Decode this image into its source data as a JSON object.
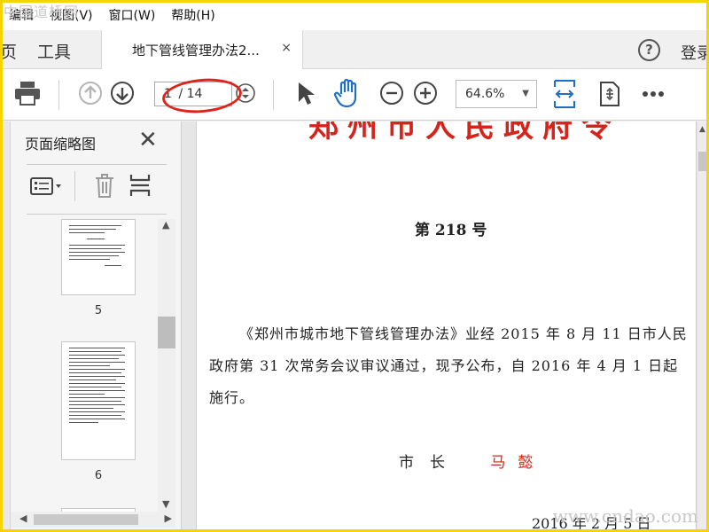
{
  "watermark": {
    "top_left": "中国道桥网",
    "bottom_right": "www.cndao.com"
  },
  "menubar": {
    "items": [
      "编辑",
      "视图(V)",
      "窗口(W)",
      "帮助(H)"
    ]
  },
  "tabs": {
    "home_partial": "页",
    "tools": "工具",
    "document": "地下管线管理办法2...",
    "close": "×",
    "help": "?",
    "login": "登录"
  },
  "toolbar": {
    "page_current": "1",
    "page_total": "/ 14",
    "zoom": "64.6%"
  },
  "left_panel": {
    "title": "页面缩略图",
    "thumbnails": [
      {
        "page_label": "5"
      },
      {
        "page_label": "6"
      }
    ]
  },
  "document": {
    "title": "郑州市人民政府令",
    "number": "第 218 号",
    "paragraph": "《郑州市城市地下管线管理办法》业经 2015 年 8 月 11 日市人民政府第 31 次常务会议审议通过，现予公布，自 2016 年 4 月 1 日起施行。",
    "sign_label": "市长",
    "sign_name": "马懿",
    "date": "2016 年 2 月 5 日"
  },
  "colors": {
    "accent_blue": "#1f6fc5",
    "title_red": "#d4251d",
    "highlight_red": "#e0231a",
    "frame_yellow": "#f5d400"
  }
}
